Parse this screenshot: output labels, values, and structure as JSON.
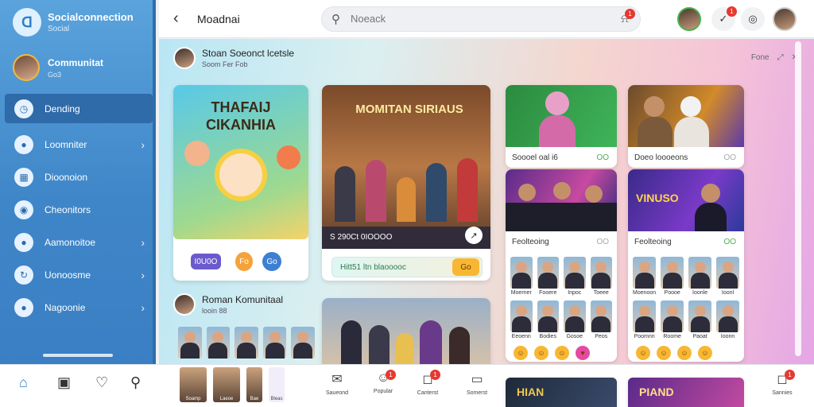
{
  "app": {
    "name": "Socialconnection",
    "sub": "Social"
  },
  "profile": {
    "name": "Communitat",
    "sub": "Go3"
  },
  "sidebar": {
    "items": [
      {
        "label": "Dending",
        "icon": "clock-icon",
        "glyph": "◷",
        "active": true
      },
      {
        "label": "Loomniter",
        "icon": "user-icon",
        "glyph": "●",
        "active": false
      },
      {
        "label": "Dioonoion",
        "icon": "calendar-icon",
        "glyph": "▦",
        "active": false
      },
      {
        "label": "Cheonitors",
        "icon": "tag-icon",
        "glyph": "◉",
        "active": false
      },
      {
        "label": "Aamonoitoe",
        "icon": "group-icon",
        "glyph": "●",
        "active": false
      },
      {
        "label": "Uonoosme",
        "icon": "refresh-icon",
        "glyph": "↻",
        "active": false
      },
      {
        "label": "Nagoonie",
        "icon": "palette-icon",
        "glyph": "●",
        "active": false
      }
    ]
  },
  "header": {
    "title": "Moadnai",
    "search_placeholder": "Noeack",
    "search_badge": "1",
    "msg_badge": "1"
  },
  "section1": {
    "title": "Stoan Soeonct lcetsle",
    "sub": "Soom Fer Fob",
    "action": "Fone"
  },
  "cards": {
    "cartoon": {
      "title": "THAFAIJ CIKANHIA",
      "pills": [
        "I0U0O",
        "Fo",
        "Go"
      ]
    },
    "family": {
      "title": "MOMITAN SIRIAUS",
      "meta": "S 290Ct 0IOOOO",
      "cta": "Hitt51 ltn blaooooc",
      "cta_btn": "Go"
    },
    "green_event": {
      "caption": "Soooel oal i6",
      "tag": "OO"
    },
    "couple": {
      "caption": "Doeo loooeons",
      "tag": "OO"
    },
    "concert": {
      "caption": "Feolteoing",
      "tag": "OO"
    },
    "vinuso": {
      "title": "VINUSO",
      "caption": "Feolteoing",
      "tag": "OO"
    }
  },
  "section2": {
    "title": "Roman Komunitaal",
    "sub": "looin 88"
  },
  "tiles_left": [
    "Toitte",
    "Hellan",
    "Iootin",
    "Isalan",
    "Lolam",
    "Bom"
  ],
  "tiles_mid": [
    "Moerner",
    "Fooere",
    "Inpoc",
    "Toeee",
    "Eeoenn",
    "Bodies",
    "Gosoe",
    "Peos"
  ],
  "tiles_right": [
    "Moenoon",
    "Poooe",
    "Ioonle",
    "Ioonl",
    "Poomnn",
    "Roome",
    "Paoat",
    "Ioonn"
  ],
  "bottom": {
    "strip": [
      "Soamp",
      "Laeoe",
      "Bae",
      "Bleas"
    ],
    "items": [
      {
        "label": "Saueond",
        "glyph": "✉",
        "badge": ""
      },
      {
        "label": "Popular",
        "glyph": "☺",
        "badge": "1"
      },
      {
        "label": "Canterst",
        "glyph": "◻",
        "badge": "1"
      },
      {
        "label": "Somerst",
        "glyph": "▭",
        "badge": ""
      },
      {
        "label": "Sannies",
        "glyph": "◻",
        "badge": "1"
      }
    ],
    "bottom_cards": [
      "HIAN",
      "PIAND"
    ]
  },
  "colors": {
    "sidebar": "#3f86c8",
    "accent": "#e6392f",
    "pill_cta": "#f7b733"
  }
}
